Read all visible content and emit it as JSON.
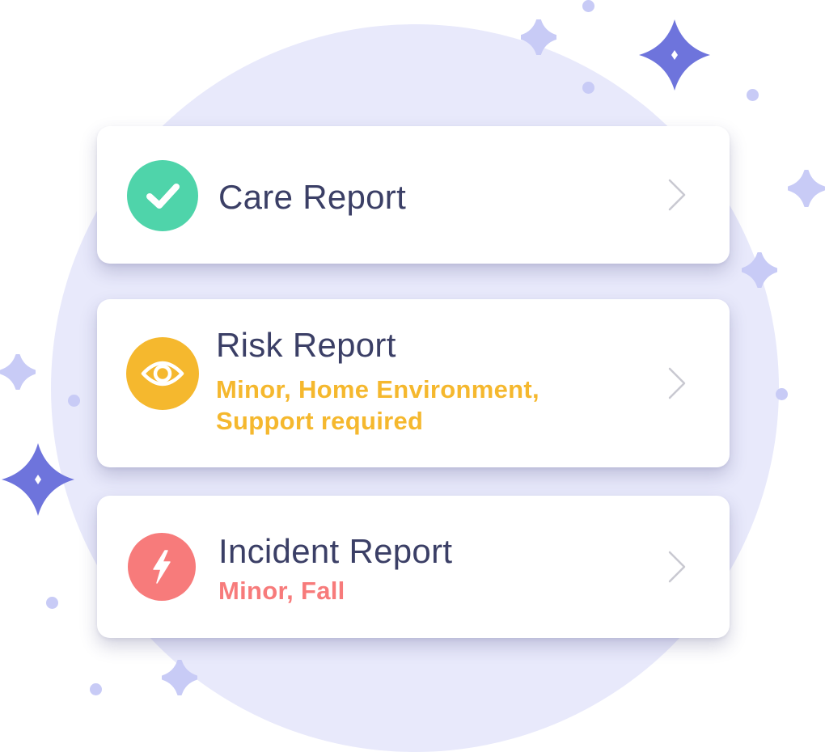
{
  "colors": {
    "background_circle": "#e8e9fb",
    "title_text": "#3b3f66",
    "care_accent": "#4fd4aa",
    "risk_accent": "#f5b82e",
    "incident_accent": "#f77b7b",
    "sparkle_dark": "#6e74dc",
    "sparkle_light": "#c8cbf6",
    "chevron": "#c9c9d1"
  },
  "reports": {
    "care": {
      "title": "Care Report",
      "icon": "checkmark-icon"
    },
    "risk": {
      "title": "Risk Report",
      "subtitle": "Minor, Home Environment, Support required",
      "icon": "eye-icon"
    },
    "incident": {
      "title": "Incident Report",
      "subtitle": "Minor, Fall",
      "icon": "lightning-bolt-icon"
    }
  }
}
